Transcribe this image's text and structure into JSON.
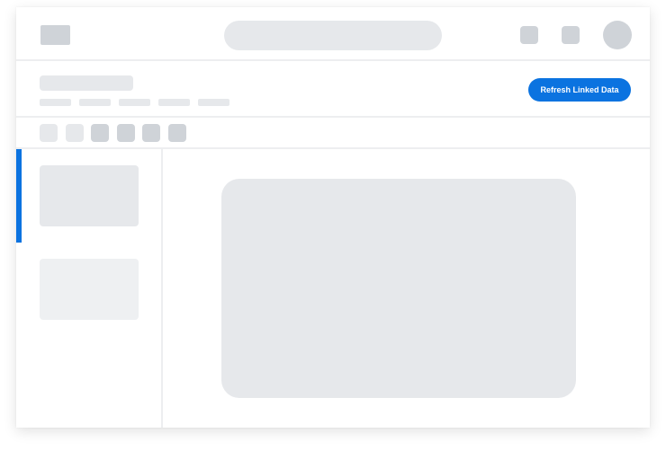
{
  "header": {
    "logo_icon": "logo-placeholder",
    "search_icon": "search-placeholder",
    "icons": [
      "app-icon-1",
      "app-icon-2"
    ],
    "avatar_icon": "avatar-placeholder"
  },
  "titlebar": {
    "refresh_label": "Refresh Linked Data"
  },
  "colors": {
    "accent": "#0b73e0",
    "skeleton": "#e6e8eb",
    "skeleton_dark": "#cfd3d8"
  }
}
